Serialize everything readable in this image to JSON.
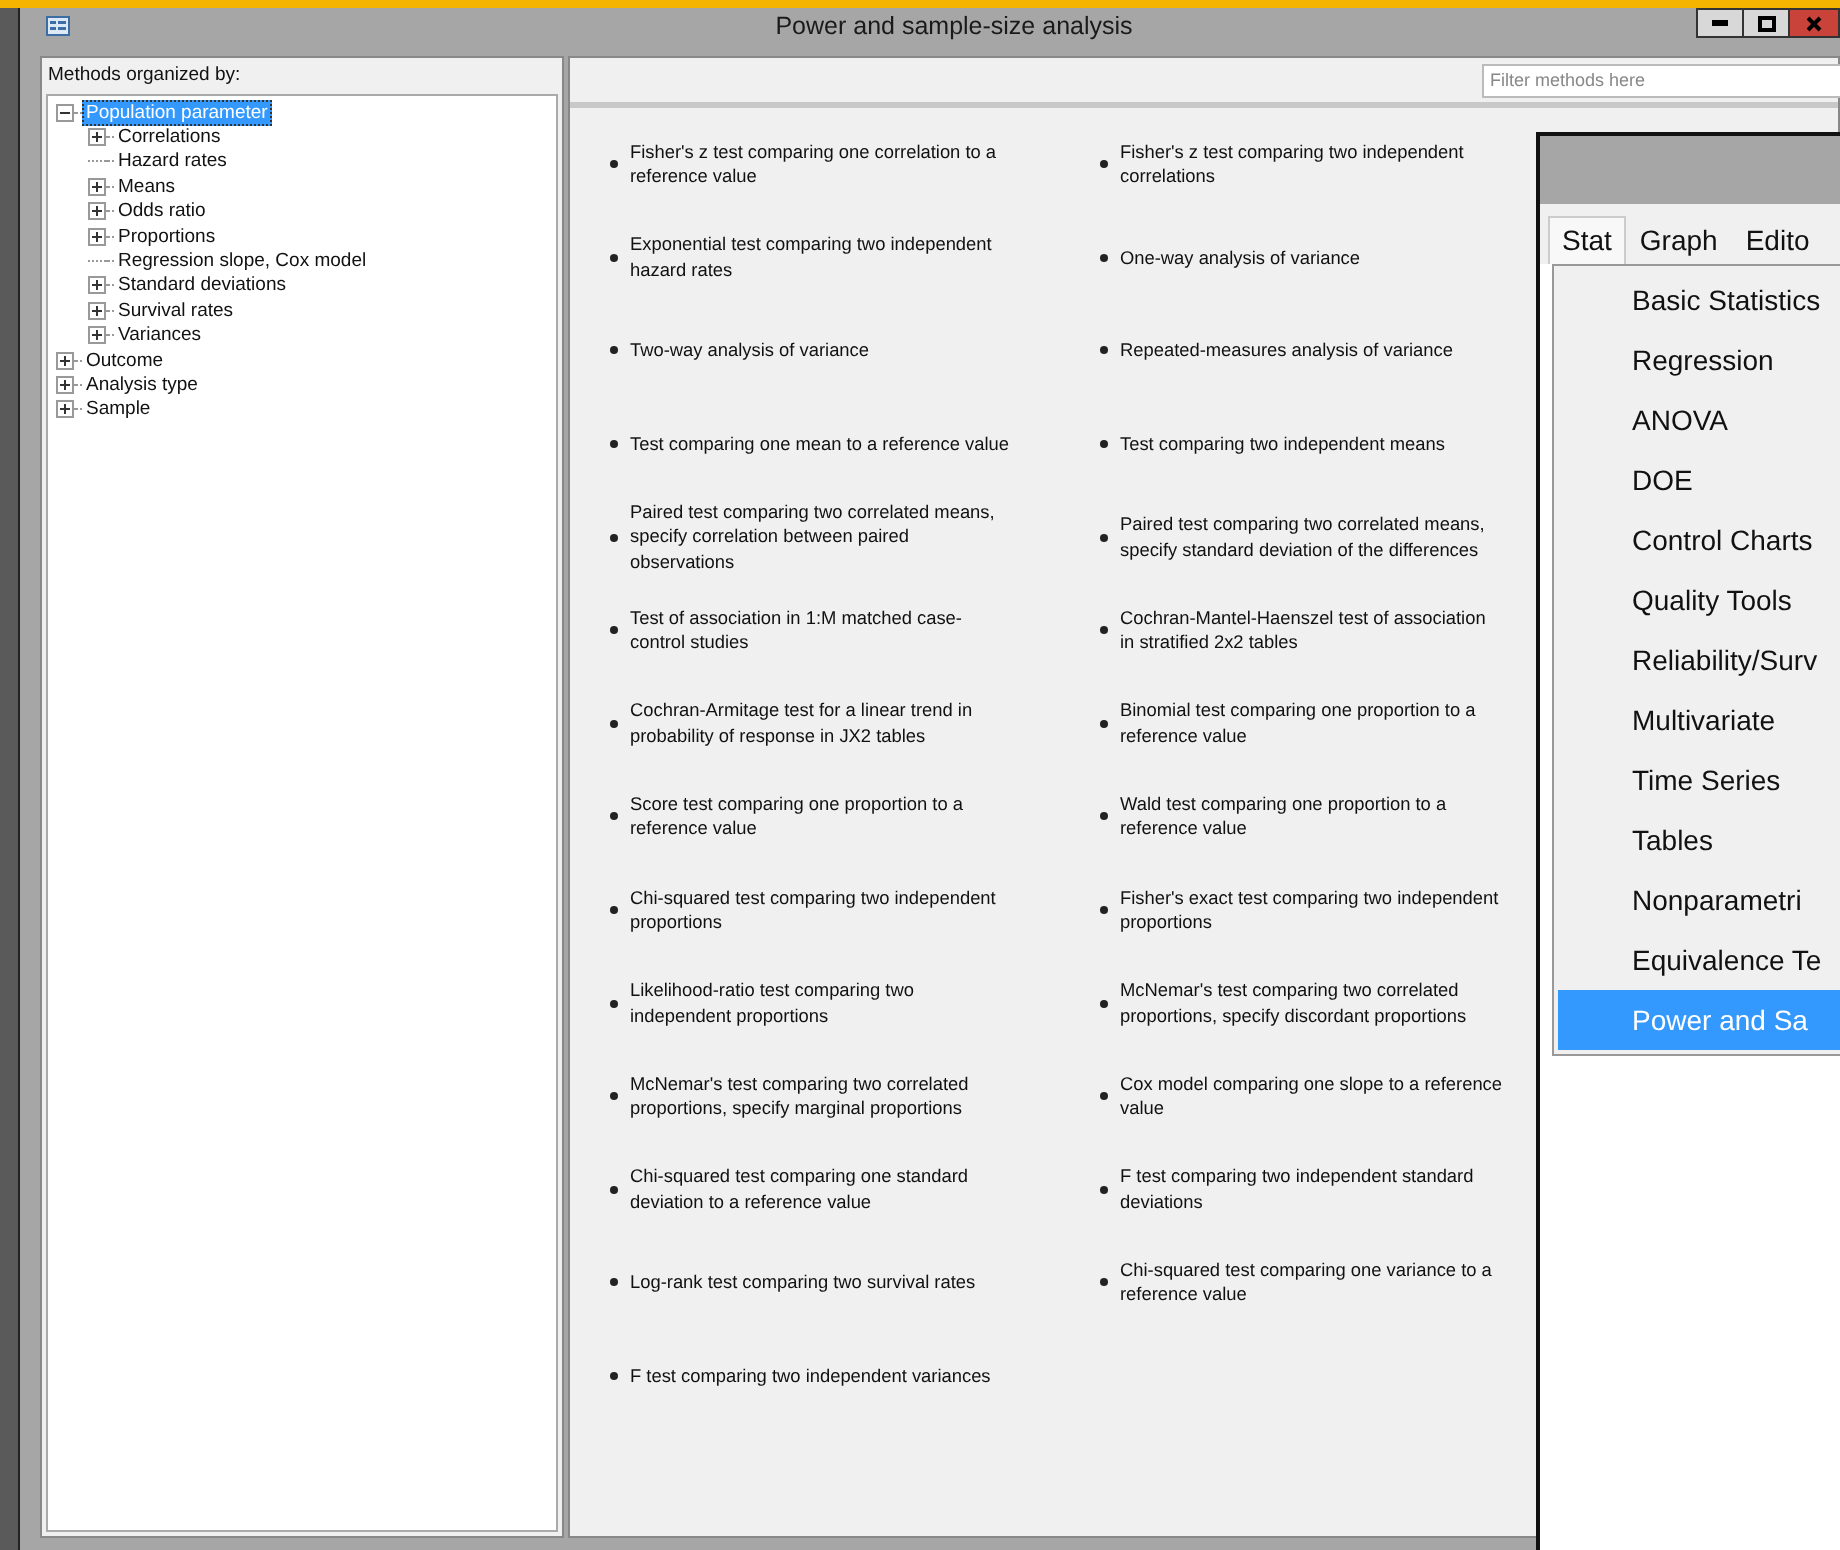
{
  "window": {
    "title": "Power and sample-size analysis"
  },
  "tree": {
    "heading": "Methods organized by:",
    "nodes": [
      {
        "label": "Population parameter",
        "kind": "branch",
        "expanded": true,
        "selected": true,
        "children": [
          {
            "label": "Correlations",
            "kind": "branch",
            "expanded": false,
            "selected": false
          },
          {
            "label": "Hazard rates",
            "kind": "leaf",
            "selected": false
          },
          {
            "label": "Means",
            "kind": "branch",
            "expanded": false,
            "selected": false
          },
          {
            "label": "Odds ratio",
            "kind": "branch",
            "expanded": false,
            "selected": false
          },
          {
            "label": "Proportions",
            "kind": "branch",
            "expanded": false,
            "selected": false
          },
          {
            "label": "Regression slope, Cox model",
            "kind": "leaf",
            "selected": false
          },
          {
            "label": "Standard deviations",
            "kind": "branch",
            "expanded": false,
            "selected": false
          },
          {
            "label": "Survival rates",
            "kind": "branch",
            "expanded": false,
            "selected": false
          },
          {
            "label": "Variances",
            "kind": "branch",
            "expanded": false,
            "selected": false
          }
        ]
      },
      {
        "label": "Outcome",
        "kind": "branch",
        "expanded": false,
        "selected": false
      },
      {
        "label": "Analysis type",
        "kind": "branch",
        "expanded": false,
        "selected": false
      },
      {
        "label": "Sample",
        "kind": "branch",
        "expanded": false,
        "selected": false
      }
    ]
  },
  "filter": {
    "placeholder": "Filter methods here"
  },
  "method_rows": [
    [
      "Fisher's z test comparing one correlation to a reference value",
      "Fisher's z test comparing two independent correlations"
    ],
    [
      "Exponential test comparing two independent hazard rates",
      "One-way analysis of variance"
    ],
    [
      "Two-way analysis of variance",
      "Repeated-measures analysis of variance"
    ],
    [
      "Test comparing one mean to a reference value",
      "Test comparing two independent means"
    ],
    [
      "Paired test comparing two correlated means, specify correlation between paired observations",
      "Paired test comparing two correlated means, specify standard deviation of the differences"
    ],
    [
      "Test of association in 1:M matched case-control studies",
      "Cochran-Mantel-Haenszel test of association in stratified 2x2 tables"
    ],
    [
      "Cochran-Armitage test for a linear trend in probability of response in JX2 tables",
      "Binomial test comparing one proportion to a reference value"
    ],
    [
      "Score test comparing one proportion to a reference value",
      "Wald test comparing one proportion to a reference value"
    ],
    [
      "Chi-squared test comparing two independent proportions",
      "Fisher's exact test comparing two independent proportions"
    ],
    [
      "Likelihood-ratio test comparing two independent proportions",
      "McNemar's test comparing two correlated proportions, specify discordant proportions"
    ],
    [
      "McNemar's test comparing two correlated proportions, specify marginal proportions",
      "Cox model comparing one slope to a reference value"
    ],
    [
      "Chi-squared test comparing one standard deviation to a reference value",
      "F test comparing two independent standard deviations"
    ],
    [
      "Log-rank test comparing two survival rates",
      "Chi-squared test comparing one variance to a reference value"
    ],
    [
      "F test comparing two independent variances"
    ]
  ],
  "overlay": {
    "menubar": [
      {
        "label": "Stat",
        "selected": true
      },
      {
        "label": "Graph",
        "selected": false
      },
      {
        "label": "Edito",
        "selected": false
      }
    ],
    "menu": [
      {
        "label": "Basic Statistics",
        "selected": false
      },
      {
        "label": "Regression",
        "selected": false
      },
      {
        "label": "ANOVA",
        "selected": false
      },
      {
        "label": "DOE",
        "selected": false
      },
      {
        "label": "Control Charts",
        "selected": false
      },
      {
        "label": "Quality Tools",
        "selected": false
      },
      {
        "label": "Reliability/Surv",
        "selected": false
      },
      {
        "label": "Multivariate",
        "selected": false
      },
      {
        "label": "Time Series",
        "selected": false
      },
      {
        "label": "Tables",
        "selected": false
      },
      {
        "label": "Nonparametri",
        "selected": false
      },
      {
        "label": "Equivalence Te",
        "selected": false
      },
      {
        "label": "Power and Sa",
        "selected": true
      }
    ]
  }
}
